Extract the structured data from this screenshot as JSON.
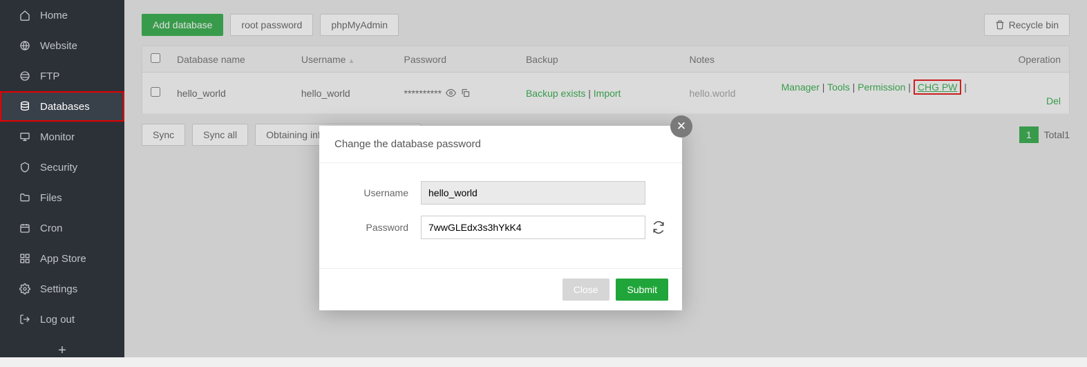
{
  "sidebar": {
    "items": [
      {
        "label": "Home"
      },
      {
        "label": "Website"
      },
      {
        "label": "FTP"
      },
      {
        "label": "Databases"
      },
      {
        "label": "Monitor"
      },
      {
        "label": "Security"
      },
      {
        "label": "Files"
      },
      {
        "label": "Cron"
      },
      {
        "label": "App Store"
      },
      {
        "label": "Settings"
      },
      {
        "label": "Log out"
      }
    ]
  },
  "toolbar": {
    "add_db": "Add database",
    "root_pw": "root password",
    "pma": "phpMyAdmin",
    "recycle": "Recycle bin"
  },
  "table": {
    "headers": {
      "dbname": "Database name",
      "username": "Username",
      "password": "Password",
      "backup": "Backup",
      "notes": "Notes",
      "operation": "Operation"
    },
    "rows": [
      {
        "dbname": "hello_world",
        "username": "hello_world",
        "password_mask": "**********",
        "backup_exists": "Backup exists",
        "backup_import": "Import",
        "notes": "hello.world",
        "ops": {
          "manager": "Manager",
          "tools": "Tools",
          "permission": "Permission",
          "chgpw": "CHG PW",
          "del": "Del"
        }
      }
    ]
  },
  "bottom": {
    "sync": "Sync",
    "sync_all": "Sync all",
    "obtaining": "Obtaining information from server",
    "page": "1",
    "total_label": "Total1"
  },
  "modal": {
    "title": "Change the database password",
    "username_label": "Username",
    "username_value": "hello_world",
    "password_label": "Password",
    "password_value": "7wwGLEdx3s3hYkK4",
    "close": "Close",
    "submit": "Submit"
  }
}
